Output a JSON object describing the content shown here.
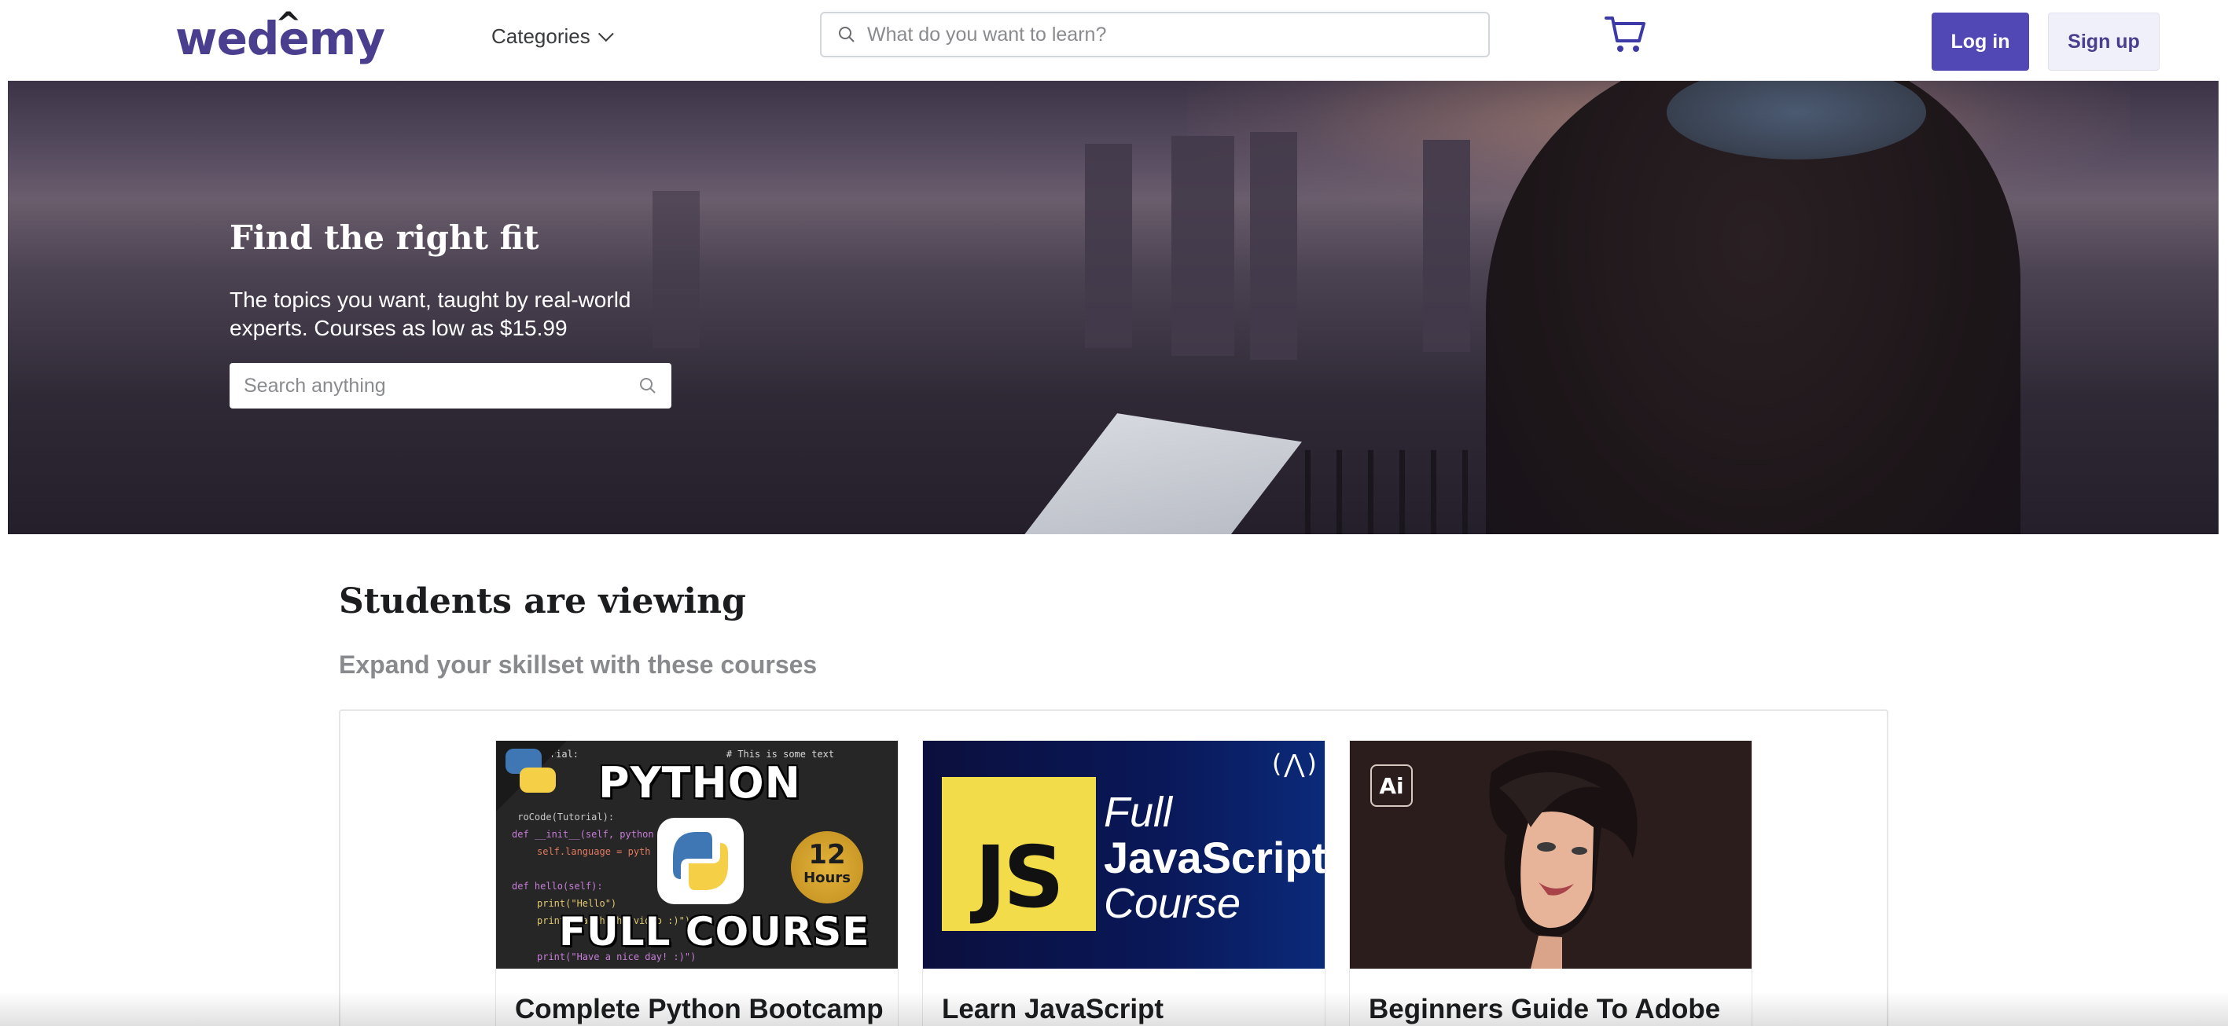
{
  "header": {
    "logo": "wedemy",
    "categories_label": "Categories",
    "search_placeholder": "What do you want to learn?",
    "login_label": "Log in",
    "signup_label": "Sign up",
    "cart_icon": "cart-icon"
  },
  "hero": {
    "title": "Find the right fit",
    "subtitle": "The topics you want, taught by real-world experts. Courses as low as $15.99",
    "search_placeholder": "Search anything"
  },
  "section": {
    "title": "Students are viewing",
    "subtitle": "Expand your skillset with these courses"
  },
  "courses": [
    {
      "title": "Complete Python Bootcamp",
      "thumb": {
        "top_text": "PYTHON",
        "bottom_text": "FULL COURSE",
        "badge_number": "12",
        "badge_unit": "Hours"
      }
    },
    {
      "title": "Learn JavaScript",
      "thumb": {
        "logo_text": "JS",
        "line1": "Full",
        "line2": "JavaScript",
        "line3": "Course",
        "corner_mark": "(⋀)"
      }
    },
    {
      "title": "Beginners Guide To Adobe",
      "thumb": {
        "app_badge": "Ai"
      }
    }
  ],
  "colors": {
    "brand": "#4a3e8f",
    "login_button": "#5147b5",
    "signup_button_bg": "#f0f0fa",
    "js_yellow": "#f2dc4a"
  }
}
